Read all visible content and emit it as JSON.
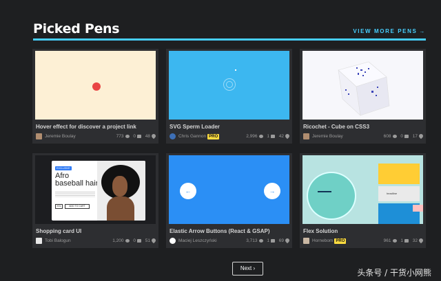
{
  "header": {
    "title": "Picked Pens",
    "view_more": "VIEW MORE PENS",
    "view_more_arrow": "→"
  },
  "cards": [
    {
      "title": "Hover effect for discover a project link",
      "author": "Jeremie Boulay",
      "pro": false,
      "views": "773",
      "comments": "0",
      "likes": "48"
    },
    {
      "title": "SVG Sperm Loader",
      "author": "Chris Gannon",
      "pro": true,
      "pro_label": "PRO",
      "views": "2,996",
      "comments": "1",
      "likes": "42"
    },
    {
      "title": "Ricochet - Cube on CSS3",
      "author": "Jeremie Boulay",
      "pro": false,
      "views": "608",
      "comments": "0",
      "likes": "17"
    },
    {
      "title": "Shopping card UI",
      "author": "Tobi Balogun",
      "pro": false,
      "views": "1,200",
      "comments": "0",
      "likes": "51",
      "preview": {
        "tag": "EXCLUSIVE",
        "heading_line1": "Afro",
        "heading_line2": "baseball hair",
        "size": "XXL",
        "button": "ADD TO CART"
      }
    },
    {
      "title": "Elastic Arrow Buttons (React & GSAP)",
      "author": "Maciej Leszczyński",
      "pro": false,
      "views": "3,713",
      "comments": "1",
      "likes": "69",
      "preview": {
        "left_arrow": "←",
        "right_arrow": "→"
      }
    },
    {
      "title": "Flex Solution",
      "author": "Hornebom",
      "pro": true,
      "pro_label": "PRO",
      "views": "961",
      "comments": "1",
      "likes": "32",
      "preview": {
        "caption": "headline"
      }
    }
  ],
  "pagination": {
    "next_label": "Next",
    "next_arrow": "›"
  },
  "watermark": "头条号 / 干货小网熊",
  "colors": {
    "accent": "#47cfff",
    "background": "#1e1f21",
    "card": "#2d2e31",
    "pro_badge": "#ffdd40"
  }
}
